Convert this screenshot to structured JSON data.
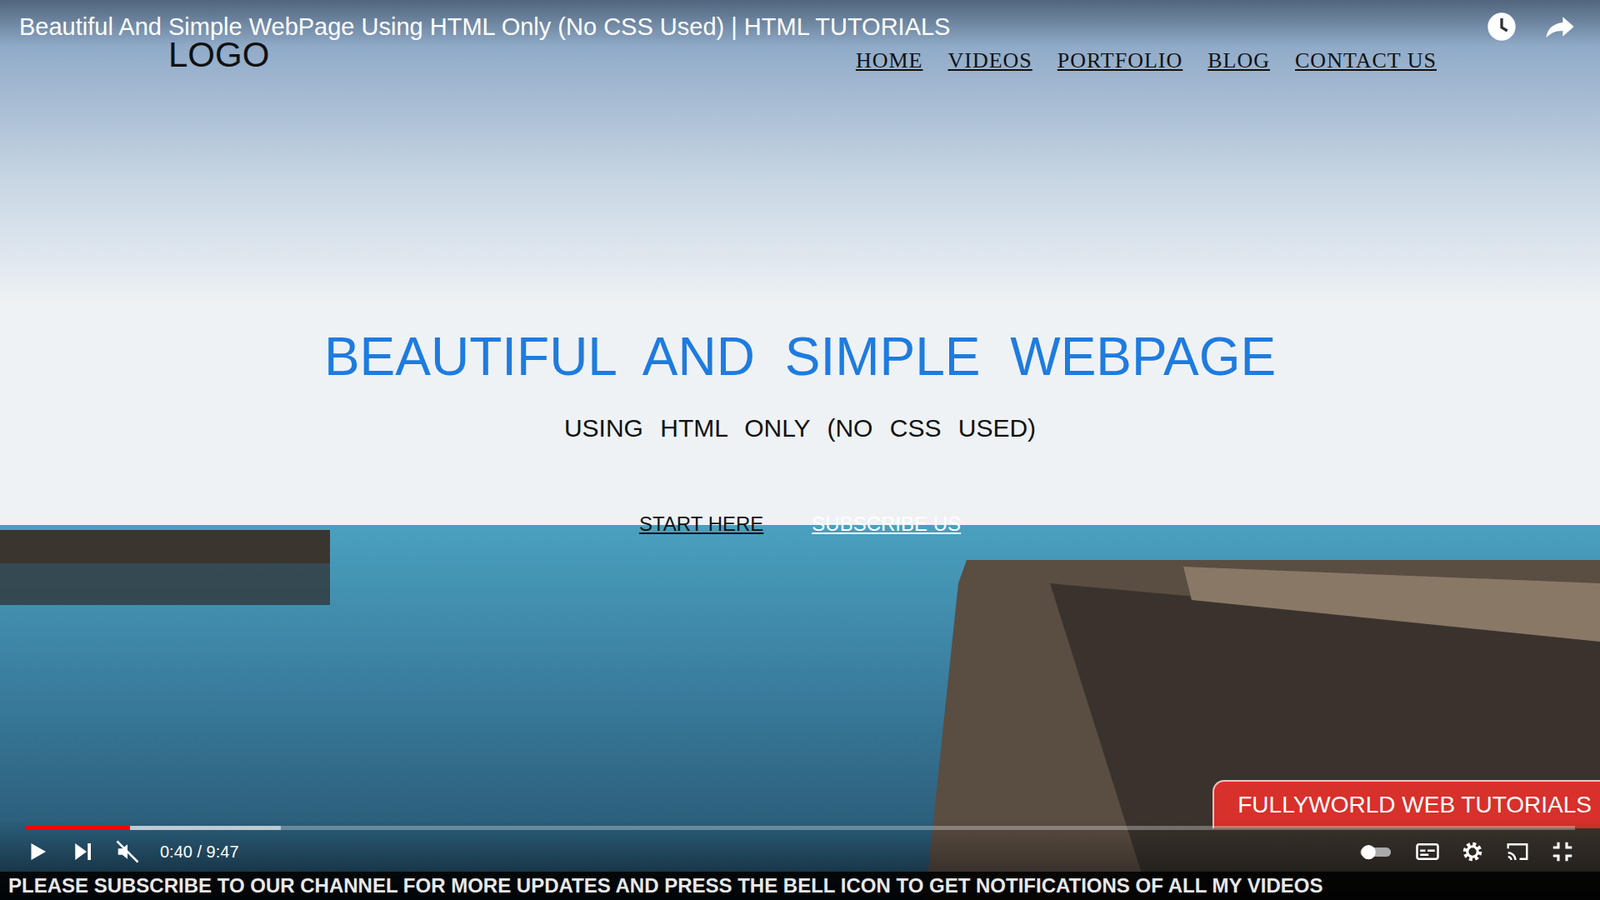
{
  "player": {
    "title": "Beautiful And Simple WebPage Using HTML Only (No CSS Used) | HTML TUTORIALS",
    "time": "0:40 / 9:47",
    "progress": 0.068,
    "buffered": 0.165,
    "playing": false,
    "muted": true
  },
  "page": {
    "logo": "LOGO",
    "nav": [
      {
        "label": "HOME"
      },
      {
        "label": "VIDEOS"
      },
      {
        "label": "PORTFOLIO"
      },
      {
        "label": "BLOG"
      },
      {
        "label": "CONTACT US"
      }
    ],
    "heading": "BEAUTIFUL AND SIMPLE WEBPAGE",
    "subheading": "USING HTML ONLY (NO CSS USED)",
    "buttons": [
      {
        "label": "START HERE",
        "color": "#111111"
      },
      {
        "label": "SUBSCRIBE US",
        "color": "#ffffff"
      }
    ]
  },
  "overlay": {
    "badge": "FULLYWORLD WEB TUTORIALS",
    "marquee": "PLEASE SUBSCRIBE TO OUR CHANNEL FOR MORE UPDATES AND PRESS THE BELL ICON TO GET NOTIFICATIONS OF ALL MY VIDEOS"
  }
}
